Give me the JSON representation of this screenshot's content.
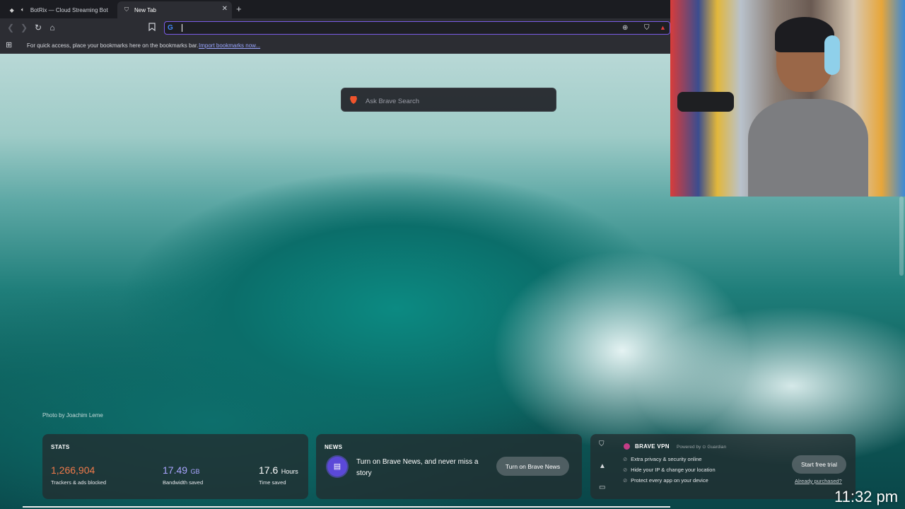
{
  "browser": {
    "tabs": [
      {
        "title": "BotRix — Cloud Streaming Bot fo",
        "favicon": "botrix-icon",
        "active": false
      },
      {
        "title": "New Tab",
        "favicon": "brave-shield-icon",
        "active": true
      }
    ],
    "omnibox": {
      "value": "",
      "provider_letter": "G"
    },
    "bookmarks_bar": {
      "message": "For quick access, place your bookmarks here on the bookmarks bar.",
      "import_link": "Import bookmarks now..."
    }
  },
  "newtab": {
    "search": {
      "placeholder": "Ask Brave Search"
    },
    "photo_credit": "Photo by Joachim Leme",
    "stats": {
      "title": "STATS",
      "trackers": {
        "value": "1,266,904",
        "label": "Trackers & ads blocked",
        "color": "#f07a4a"
      },
      "bandwidth": {
        "value": "17.49",
        "unit": "GB",
        "label": "Bandwidth saved",
        "color": "#a9a4ff"
      },
      "time": {
        "value": "17.6",
        "unit": "Hours",
        "label": "Time saved",
        "color": "#ffffff"
      }
    },
    "news": {
      "title": "NEWS",
      "text": "Turn on Brave News, and never miss a story",
      "button": "Turn on Brave News"
    },
    "vpn": {
      "title": "BRAVE VPN",
      "powered_by": "Powered by ⊙ Guardian",
      "features": [
        "Extra privacy & security online",
        "Hide your IP & change your location",
        "Protect every app on your device"
      ],
      "button": "Start free trial",
      "already": "Already purchased?"
    }
  },
  "overlay": {
    "clock": "11:32 pm"
  },
  "colors": {
    "accent": "#7b5ce6",
    "toolbar": "#2c2d33",
    "tabstrip": "#1b1c21"
  }
}
